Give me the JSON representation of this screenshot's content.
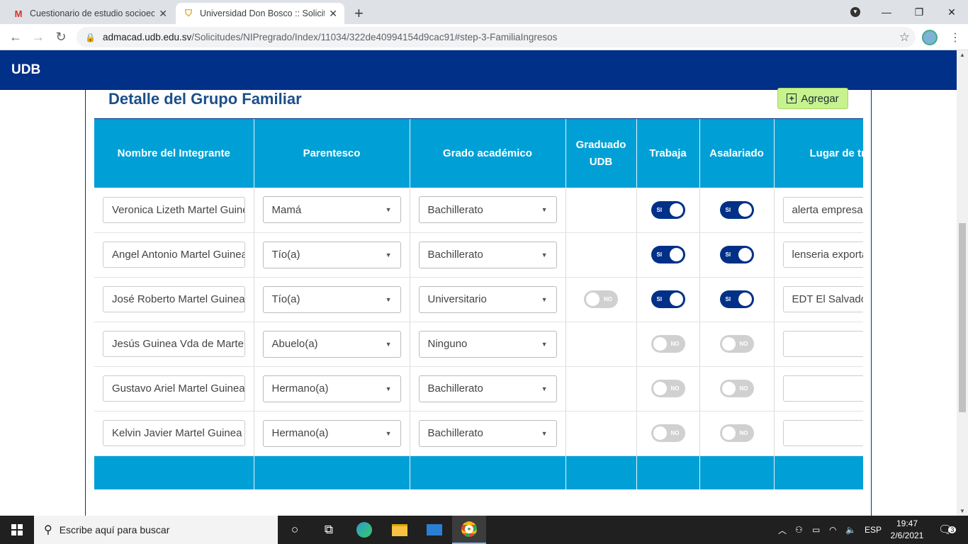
{
  "browser": {
    "tabs": [
      {
        "title": "Cuestionario de estudio socioeconómico",
        "icon": "gmail-icon"
      },
      {
        "title": "Universidad Don Bosco :: Solicitudes",
        "icon": "udb-icon"
      }
    ],
    "url_domain": "admacad.udb.edu.sv",
    "url_path": "/Solicitudes/NIPregrado/Index/11034/322de40994154d9cac91#step-3-FamiliaIngresos"
  },
  "app": {
    "brand": "UDB"
  },
  "section": {
    "title": "Detalle del Grupo Familiar",
    "add_label": "Agregar"
  },
  "table": {
    "headers": [
      "Nombre del Integrante",
      "Parentesco",
      "Grado académico",
      "Graduado UDB",
      "Trabaja",
      "Asalariado",
      "Lugar de trabajo"
    ],
    "rows": [
      {
        "nombre": "Veronica Lizeth Martel Guinea",
        "parentesco": "Mamá",
        "grado": "Bachillerato",
        "graduado": null,
        "trabaja": "SI",
        "asalariado": "SI",
        "lugar": "alerta empresarial"
      },
      {
        "nombre": "Angel Antonio Martel Guinea",
        "parentesco": "Tío(a)",
        "grado": "Bachillerato",
        "graduado": null,
        "trabaja": "SI",
        "asalariado": "SI",
        "lugar": "lenseria exportadora"
      },
      {
        "nombre": "José Roberto Martel Guinea",
        "parentesco": "Tío(a)",
        "grado": "Universitario",
        "graduado": "NO",
        "trabaja": "SI",
        "asalariado": "SI",
        "lugar": "EDT El Salvador"
      },
      {
        "nombre": "Jesús Guinea Vda de Martel",
        "parentesco": "Abuelo(a)",
        "grado": "Ninguno",
        "graduado": null,
        "trabaja": "NO",
        "asalariado": "NO",
        "lugar": ""
      },
      {
        "nombre": "Gustavo Ariel Martel Guinea",
        "parentesco": "Hermano(a)",
        "grado": "Bachillerato",
        "graduado": null,
        "trabaja": "NO",
        "asalariado": "NO",
        "lugar": ""
      },
      {
        "nombre": "Kelvin Javier Martel Guinea",
        "parentesco": "Hermano(a)",
        "grado": "Bachillerato",
        "graduado": null,
        "trabaja": "NO",
        "asalariado": "NO",
        "lugar": ""
      }
    ]
  },
  "taskbar": {
    "search_placeholder": "Escribe aquí para buscar",
    "lang": "ESP",
    "time": "19:47",
    "date": "2/6/2021",
    "notifications": "3"
  }
}
